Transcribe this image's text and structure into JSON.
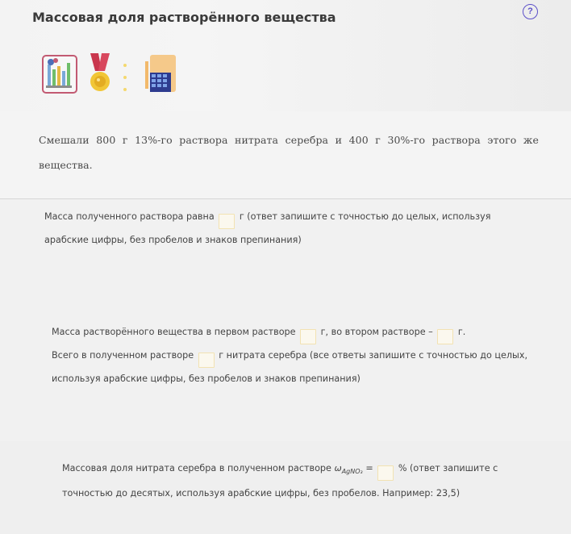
{
  "header": {
    "title": "Массовая доля растворённого вещества",
    "help_label": "?"
  },
  "tools": {
    "items": [
      {
        "name": "lab-tool",
        "icon": "flask-icon"
      },
      {
        "name": "medal-tool",
        "icon": "medal-icon"
      },
      {
        "name": "calculator-tool",
        "icon": "calculator-icon"
      }
    ]
  },
  "problem": {
    "text": "Смешали 800 г 13%-го раствора нитрата серебра и 400 г 30%-го раствора этого же вещества."
  },
  "questions": {
    "q1": {
      "before": "Масса полученного раствора равна",
      "after": "г (ответ запишите с точностью до целых, используя арабские цифры, без пробелов и знаков препинания)",
      "answer": ""
    },
    "q2": {
      "part1": "Масса растворённого вещества в первом растворе",
      "part2": "г, во втором растворе –",
      "part3": "г.",
      "part4": "Всего в полученном растворе",
      "part5": "г нитрата серебра (все ответы запишите с точностью до целых, используя арабские цифры, без пробелов и знаков препинания)",
      "answer1": "",
      "answer2": "",
      "answer3": ""
    },
    "q3": {
      "before": "Массовая доля нитрата серебра в полученном растворе",
      "omega": "ω",
      "subscript": "AgNO₃",
      "equals": "=",
      "after": "% (ответ запишите с точностью до десятых, используя арабские цифры, без пробелов. Например: 23,5)",
      "answer": ""
    }
  },
  "colors": {
    "accent": "#5c50c9",
    "lab_border": "#c25a72",
    "input_border": "#f2e2b2"
  }
}
